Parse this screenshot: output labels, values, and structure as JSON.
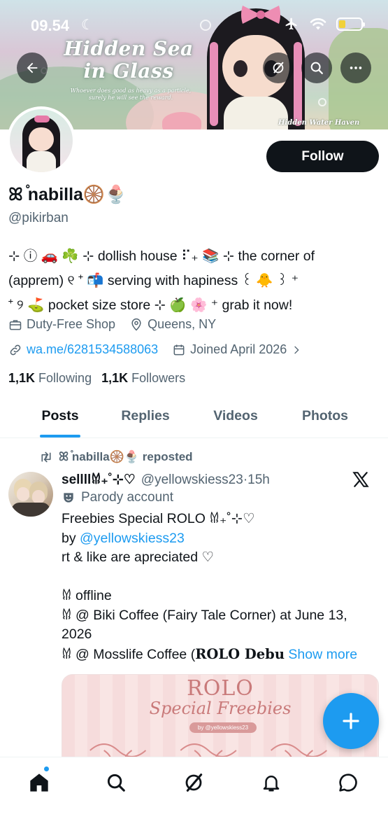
{
  "status_bar": {
    "time": "09.54",
    "moon_glyph": "☾",
    "battery_level": 0.3,
    "battery_color": "#f1d13a"
  },
  "banner": {
    "title_line1": "Hidden Sea",
    "title_line2": "in Glass",
    "quote": "Whoever does good as heavy as a particle, surely he will see the reward.",
    "brand": "Hidden Water Haven"
  },
  "header_actions": {
    "back_icon": "arrow-left-icon",
    "grok_icon": "slash-circle-icon",
    "search_icon": "search-icon",
    "more_icon": "more-horizontal-icon"
  },
  "profile": {
    "display_name": "ꕤ ֯nabilla🛞🍨",
    "handle": "@pikirban",
    "follow_label": "Follow",
    "bio_lines": [
      "⊹ ⓘ 🚗 ☘️ ⊹ dollish house ⠏₊ 📚 ⊹ the corner of",
      "(apprem) ୧ ⁺ 📬 serving with hapiness ꒰ 🐥 ꒱ ⁺",
      "⁺ ୨ ⛳ pocket size store ⊹ 🍏 🌸 ⁺ grab it now!"
    ],
    "category": "Duty-Free Shop",
    "location": "Queens, NY",
    "website": "wa.me/6281534588063",
    "joined": "Joined April 2026",
    "following_count": "1,1K",
    "following_label": "Following",
    "followers_count": "1,1K",
    "followers_label": "Followers"
  },
  "tabs": [
    {
      "label": "Posts",
      "active": true
    },
    {
      "label": "Replies",
      "active": false
    },
    {
      "label": "Videos",
      "active": false
    },
    {
      "label": "Photos",
      "active": false
    }
  ],
  "post": {
    "repost_by": "ꕤ ֯nabilla🛞🍨 reposted",
    "author": "sellll𐀔₊˚⊹♡",
    "handle": "@yellowskiess23",
    "separator": "·",
    "time": "15h",
    "parody_label": "Parody account",
    "line1": "Freebies Special ROLO 𐀔₊˚⊹♡",
    "line2_prefix": "by ",
    "line2_link": "@yellowskiess23",
    "line3": "rt & like are apreciated ♡",
    "line4": "",
    "line5": "𐀔 offline",
    "line6": "𐀔 @ Biki Coffee (Fairy Tale Corner) at June 13, 2026",
    "line7_text": "𐀔 @ Mosslife Coffee (",
    "line7_bold": "𝐑𝐎𝐋𝐎 𝐃𝐞𝐛𝐮",
    "show_more": "Show more",
    "media_title": "ROLO",
    "media_subtitle": "Special Freebies",
    "media_credit": "by @yellowskiess23"
  },
  "fab": {
    "icon": "plus-icon"
  },
  "bottom_nav": {
    "items": [
      "home-icon",
      "search-icon",
      "grok-icon",
      "notifications-icon",
      "messages-icon"
    ],
    "has_unread_dot": true
  },
  "colors": {
    "accent": "#1d9bf0",
    "text_primary": "#0f1419",
    "text_secondary": "#536471",
    "follow_bg": "#0f1419"
  }
}
